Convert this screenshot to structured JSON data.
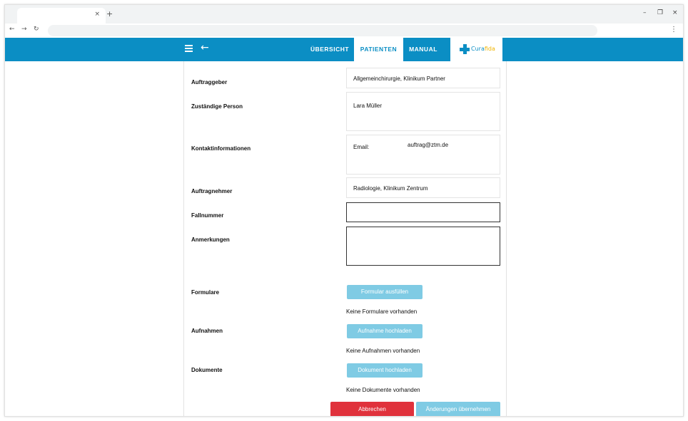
{
  "browser": {
    "tab_close": "×",
    "new_tab": "+",
    "back": "←",
    "forward": "→",
    "reload": "↻",
    "minimize": "–",
    "restore": "❐",
    "close": "×",
    "menu": "⋮"
  },
  "appbar": {
    "back_icon": "←",
    "tabs": [
      {
        "label": "ÜBERSICHT"
      },
      {
        "label": "PATIENTEN"
      },
      {
        "label": "MANUAL"
      }
    ],
    "active_tab": "PATIENTEN",
    "logo": {
      "part1": "Cura",
      "part2": "fida"
    }
  },
  "form": {
    "auftraggeber": {
      "label": "Auftraggeber",
      "value": "Allgemeinchirurgie, Klinikum Partner"
    },
    "zustaendige_person": {
      "label": "Zuständige Person",
      "value": "Lara Müller"
    },
    "kontakt": {
      "label": "Kontaktinformationen",
      "email_label": "Email:",
      "email_value": "auftrag@ztm.de"
    },
    "auftragnehmer": {
      "label": "Auftragnehmer",
      "value": "Radiologie, Klinikum Zentrum"
    },
    "fallnummer": {
      "label": "Fallnummer",
      "value": ""
    },
    "anmerkungen": {
      "label": "Anmerkungen",
      "value": ""
    },
    "formulare": {
      "label": "Formulare",
      "button": "Formular ausfüllen",
      "empty": "Keine Formulare vorhanden"
    },
    "aufnahmen": {
      "label": "Aufnahmen",
      "button": "Aufnahme hochladen",
      "empty": "Keine Aufnahmen vorhanden"
    },
    "dokumente": {
      "label": "Dokumente",
      "button": "Dokument hochladen",
      "empty": "Keine Dokumente vorhanden"
    }
  },
  "actions": {
    "cancel": "Abbrechen",
    "apply": "Änderungen übernehmen"
  },
  "colors": {
    "primary": "#0b8ec4",
    "button_light": "#7fcbe4",
    "danger": "#e0323c",
    "logo_accent": "#f0b400"
  }
}
